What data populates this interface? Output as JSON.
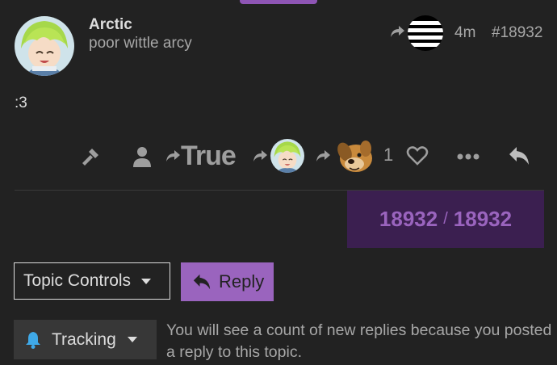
{
  "post": {
    "username": "Arctic",
    "user_title": "poor wittle arcy",
    "age": "4m",
    "post_number": "#18932",
    "body": ":3"
  },
  "actions": {
    "reply_to_name": "True",
    "like_count": "1"
  },
  "progress": {
    "current": "18932",
    "separator": "/",
    "total": "18932"
  },
  "topic_controls": {
    "label": "Topic Controls"
  },
  "reply_button": {
    "label": "Reply"
  },
  "notifications": {
    "level": "Tracking",
    "description": "You will see a count of new replies because you posted a reply to this topic."
  },
  "colors": {
    "accent": "#9a64be",
    "progress_bg": "#3b1f50",
    "background": "#222222"
  }
}
